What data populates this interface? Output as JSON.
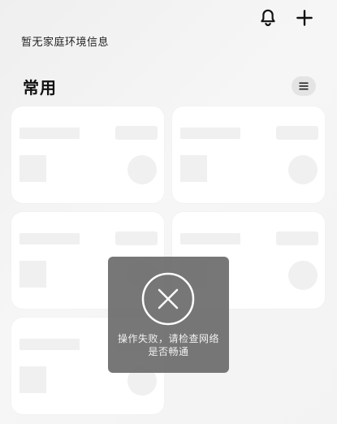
{
  "header": {
    "home_env_text": "暂无家庭环境信息",
    "icons": {
      "notification": "bell-icon",
      "add": "plus-icon"
    }
  },
  "section": {
    "title": "常用",
    "menu_icon": "list-icon"
  },
  "cards": {
    "count": 5,
    "state": "loading"
  },
  "toast": {
    "icon": "close-circle-icon",
    "message": "操作失败，请检查网络是否畅通"
  },
  "colors": {
    "background": "#f3f3f3",
    "card": "#ffffff",
    "skeleton": "#f0f0f0",
    "toast_bg": "#646464",
    "toast_text": "#f2f2f2",
    "menu_btn_bg": "#e4e4e4"
  }
}
